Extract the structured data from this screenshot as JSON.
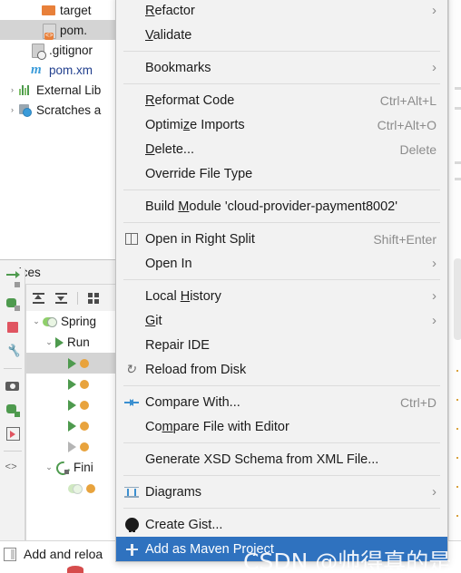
{
  "project_tree": {
    "rows": [
      {
        "label": "target",
        "icon": "folder-orange-icon",
        "selected": false,
        "indent": 34,
        "arrow": ""
      },
      {
        "label": "pom.",
        "icon": "pom-module-icon",
        "selected": true,
        "indent": 34,
        "arrow": ""
      },
      {
        "label": ".gitignor",
        "icon": "gitignore-file-icon",
        "selected": false,
        "indent": 22,
        "arrow": ""
      },
      {
        "label": "pom.xm",
        "icon": "maven-m-icon",
        "selected": false,
        "indent": 22,
        "arrow": ""
      },
      {
        "label": "External Lib",
        "icon": "external-libraries-icon",
        "selected": false,
        "indent": 8,
        "arrow": "›"
      },
      {
        "label": "Scratches a",
        "icon": "scratches-icon",
        "selected": false,
        "indent": 8,
        "arrow": "›"
      }
    ]
  },
  "services": {
    "title": "ervices",
    "toolbar": {
      "expand_all_label": "expand-all",
      "collapse_all_label": "collapse-all",
      "group_label": "group-by"
    },
    "tree": [
      {
        "label": "Spring",
        "icon": "spring-icon",
        "chevron": "⌄",
        "indent": 4,
        "selected": false
      },
      {
        "label": "Run",
        "icon": "run-icon",
        "chevron": "⌄",
        "indent": 18,
        "selected": false
      },
      {
        "label": "",
        "icon": "run-icon",
        "chevron": "",
        "indent": 32,
        "selected": true
      },
      {
        "label": "",
        "icon": "run-icon",
        "chevron": "",
        "indent": 32,
        "selected": false
      },
      {
        "label": "",
        "icon": "run-icon",
        "chevron": "",
        "indent": 32,
        "selected": false
      },
      {
        "label": "",
        "icon": "run-icon",
        "chevron": "",
        "indent": 32,
        "selected": false
      },
      {
        "label": "",
        "icon": "run-icon-grey",
        "chevron": "",
        "indent": 32,
        "selected": false
      },
      {
        "label": "Fini",
        "icon": "reload-icon",
        "chevron": "⌄",
        "indent": 18,
        "selected": false
      },
      {
        "label": "",
        "icon": "spring-icon-faint",
        "chevron": "",
        "indent": 32,
        "selected": false
      }
    ]
  },
  "side_toolbar": {
    "icons": [
      "run-icon",
      "debug-icon",
      "stop-icon",
      "settings-wrench-icon",
      "camera-icon",
      "rerun-icon",
      "step-into-icon",
      "code-icon",
      "layout-icon"
    ]
  },
  "status_bar": {
    "icon": "panel-icon",
    "text": "Add and reloa"
  },
  "context_menu": {
    "accent_highlight": "#2f72bf",
    "background": "#f2f2f2",
    "items": [
      {
        "type": "item",
        "label": "Refactor",
        "mnemonic": "R",
        "accel": "",
        "submenu": true,
        "icon": "",
        "selected": false
      },
      {
        "type": "item",
        "label": "Validate",
        "mnemonic": "V",
        "accel": "",
        "submenu": false,
        "icon": "",
        "selected": false
      },
      {
        "type": "separator"
      },
      {
        "type": "item",
        "label": "Bookmarks",
        "mnemonic": "",
        "accel": "",
        "submenu": true,
        "icon": "",
        "selected": false
      },
      {
        "type": "separator"
      },
      {
        "type": "item",
        "label": "Reformat Code",
        "mnemonic": "R",
        "accel": "Ctrl+Alt+L",
        "submenu": false,
        "icon": "",
        "selected": false
      },
      {
        "type": "item",
        "label": "Optimize Imports",
        "mnemonic": "z",
        "accel": "Ctrl+Alt+O",
        "submenu": false,
        "icon": "",
        "selected": false
      },
      {
        "type": "item",
        "label": "Delete...",
        "mnemonic": "D",
        "accel": "Delete",
        "submenu": false,
        "icon": "",
        "selected": false
      },
      {
        "type": "item",
        "label": "Override File Type",
        "mnemonic": "",
        "accel": "",
        "submenu": false,
        "icon": "",
        "selected": false
      },
      {
        "type": "separator"
      },
      {
        "type": "item",
        "label": "Build Module 'cloud-provider-payment8002'",
        "mnemonic": "M",
        "accel": "",
        "submenu": false,
        "icon": "",
        "selected": false
      },
      {
        "type": "separator"
      },
      {
        "type": "item",
        "label": "Open in Right Split",
        "mnemonic": "",
        "accel": "Shift+Enter",
        "submenu": false,
        "icon": "split-icon",
        "selected": false
      },
      {
        "type": "item",
        "label": "Open In",
        "mnemonic": "",
        "accel": "",
        "submenu": true,
        "icon": "",
        "selected": false
      },
      {
        "type": "separator"
      },
      {
        "type": "item",
        "label": "Local History",
        "mnemonic": "H",
        "accel": "",
        "submenu": true,
        "icon": "",
        "selected": false
      },
      {
        "type": "item",
        "label": "Git",
        "mnemonic": "G",
        "accel": "",
        "submenu": true,
        "icon": "",
        "selected": false
      },
      {
        "type": "item",
        "label": "Repair IDE",
        "mnemonic": "",
        "accel": "",
        "submenu": false,
        "icon": "",
        "selected": false
      },
      {
        "type": "item",
        "label": "Reload from Disk",
        "mnemonic": "",
        "accel": "",
        "submenu": false,
        "icon": "reload-icon",
        "selected": false
      },
      {
        "type": "separator"
      },
      {
        "type": "item",
        "label": "Compare With...",
        "mnemonic": "",
        "accel": "Ctrl+D",
        "submenu": false,
        "icon": "compare-icon",
        "selected": false
      },
      {
        "type": "item",
        "label": "Compare File with Editor",
        "mnemonic": "m",
        "accel": "",
        "submenu": false,
        "icon": "",
        "selected": false
      },
      {
        "type": "separator"
      },
      {
        "type": "item",
        "label": "Generate XSD Schema from XML File...",
        "mnemonic": "",
        "accel": "",
        "submenu": false,
        "icon": "",
        "selected": false
      },
      {
        "type": "separator"
      },
      {
        "type": "item",
        "label": "Diagrams",
        "mnemonic": "",
        "accel": "",
        "submenu": true,
        "icon": "diagram-icon",
        "selected": false
      },
      {
        "type": "separator"
      },
      {
        "type": "item",
        "label": "Create Gist...",
        "mnemonic": "",
        "accel": "",
        "submenu": false,
        "icon": "github-icon",
        "selected": false
      },
      {
        "type": "item",
        "label": "Add as Maven Project",
        "mnemonic": "",
        "accel": "",
        "submenu": false,
        "icon": "plus-icon",
        "selected": true
      }
    ]
  },
  "watermark": {
    "text": "CSDN @帅得真的是无敌了"
  }
}
